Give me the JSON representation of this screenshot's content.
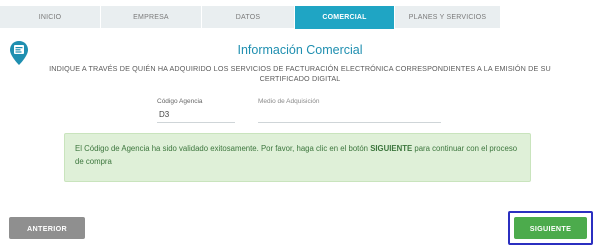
{
  "tabs": [
    {
      "label": "INICIO",
      "active": false
    },
    {
      "label": "EMPRESA",
      "active": false
    },
    {
      "label": "DATOS",
      "active": false
    },
    {
      "label": "COMERCIAL",
      "active": true
    },
    {
      "label": "PLANES Y SERVICIOS",
      "active": false
    }
  ],
  "header": {
    "title": "Información Comercial",
    "subtitle": "INDIQUE A TRAVÉS DE QUIÉN HA ADQUIRIDO LOS SERVICIOS DE FACTURACIÓN ELECTRÓNICA CORRESPONDIENTES A LA EMISIÓN DE SU CERTIFICADO DIGITAL"
  },
  "form": {
    "agency_label": "Código Agencia",
    "agency_value": "D3",
    "acquisition_placeholder": "Medio de Adquisición"
  },
  "alert": {
    "text_before": "El Código de Agencia ha sido validado exitosamente. Por favor, haga clic en el botón ",
    "text_bold": "SIGUIENTE",
    "text_after": " para continuar con el proceso de compra"
  },
  "buttons": {
    "prev": "ANTERIOR",
    "next": "SIGUIENTE"
  },
  "colors": {
    "accent": "#1fa5c4",
    "success_bg": "#dff0d8",
    "next_button": "#4cab4c",
    "prev_button": "#8f8f8f",
    "focus_outline": "#2b2fc0"
  },
  "icons": {
    "logo": "certificate-badge-icon"
  }
}
